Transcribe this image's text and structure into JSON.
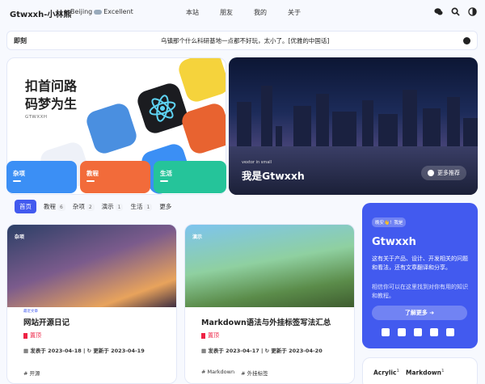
{
  "header": {
    "brand": "Gtwxxh-小林熊",
    "weather_city": "Beijing",
    "weather_status": "Excellent",
    "menu": [
      "本站",
      "朋友",
      "我的",
      "关于"
    ]
  },
  "notice": {
    "tag": "即刻",
    "text": "乌镇那个什么科研基地一点都不好玩，太小了。[优雅的中国话]"
  },
  "hero": {
    "slogan_line1": "扣首问路",
    "slogan_line2": "码梦为生",
    "slogan_sub": "GTWXXH",
    "categories": [
      {
        "label": "杂项",
        "color": "#3b8ff5"
      },
      {
        "label": "教程",
        "color": "#f26b3a"
      },
      {
        "label": "生活",
        "color": "#25c49a"
      }
    ],
    "featured_label": "vextor in small",
    "featured_title": "我是Gtwxxh",
    "featured_button": "更多推荐"
  },
  "category_tabs": [
    {
      "label": "首页",
      "count": ""
    },
    {
      "label": "教程",
      "count": "6"
    },
    {
      "label": "杂项",
      "count": "2"
    },
    {
      "label": "演示",
      "count": "1"
    },
    {
      "label": "生活",
      "count": "1"
    },
    {
      "label": "更多",
      "count": ""
    }
  ],
  "posts": [
    {
      "cover_tag": "杂项",
      "label": "最近文章",
      "title": "网站开源日记",
      "pinned": "置顶",
      "published": "发表于 2023-04-18",
      "updated": "更新于 2023-04-19",
      "tags": [
        "开源"
      ]
    },
    {
      "cover_tag": "演示",
      "label": "",
      "title": "Markdown语法与外挂标签写法汇总",
      "pinned": "置顶",
      "published": "发表于 2023-04-17",
      "updated": "更新于 2023-04-20",
      "tags": [
        "Markdown",
        "外挂标签"
      ]
    }
  ],
  "author": {
    "hello": "晚安👋！我是",
    "name": "Gtwxxh",
    "desc1": "这有关于产品、设计、开发相关的问题和看法，还有文章翻译和分享。",
    "desc2": "相信你可以在这里找到对你有用的知识和教程。",
    "more": "了解更多"
  },
  "tag_cloud": [
    {
      "name": "Acrylic",
      "count": "1"
    },
    {
      "name": "Markdown",
      "count": "1"
    }
  ]
}
